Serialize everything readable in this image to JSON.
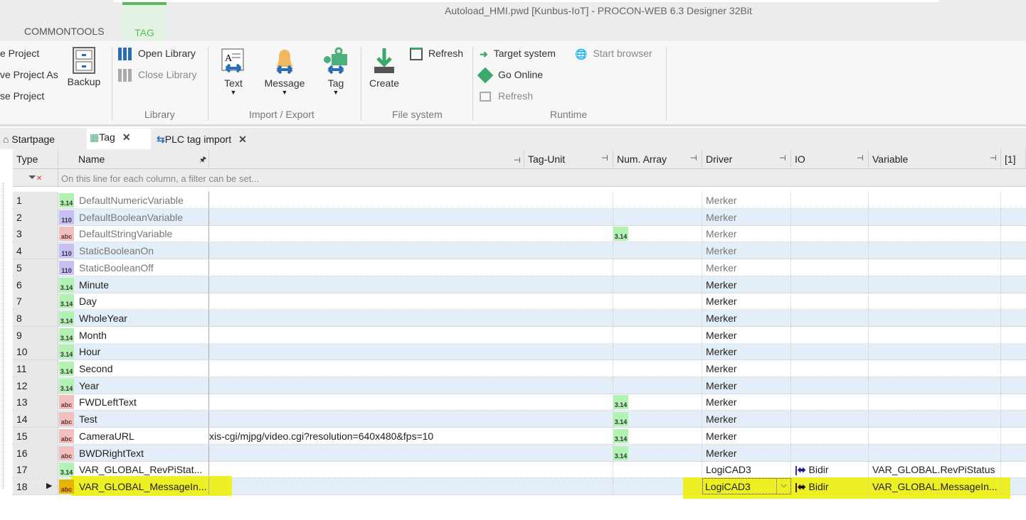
{
  "window": {
    "title": "Autoload_HMI.pwd [Kunbus-IoT] - PROCON-WEB 6.3 Designer 32Bit"
  },
  "ribbon_tabs": [
    "COMMONTOOLS",
    "TAG"
  ],
  "ribbon": {
    "project": [
      "e Project",
      "ve Project As",
      "se Project"
    ],
    "backup": "Backup",
    "library": {
      "open": "Open Library",
      "close": "Close Library",
      "label": "Library"
    },
    "import_export": {
      "text": "Text",
      "message": "Message",
      "tag": "Tag",
      "label": "Import / Export"
    },
    "file_system": {
      "create": "Create",
      "refresh": "Refresh",
      "label": "File system"
    },
    "runtime": {
      "target": "Target system",
      "browser": "Start browser",
      "online": "Go Online",
      "refresh": "Refresh",
      "label": "Runtime"
    }
  },
  "doc_tabs": [
    "Startpage",
    "Tag",
    "PLC tag import"
  ],
  "columns": [
    "Type",
    "Name",
    "",
    "Tag-Unit",
    "Num. Array",
    "Driver",
    "IO",
    "Variable",
    "[1]"
  ],
  "filter_placeholder": "On this line for each column, a filter can be set...",
  "type_icons": {
    "num": "3.14",
    "bool": "110",
    "str": "abc"
  },
  "highlight_color": "#eef000",
  "rows": [
    {
      "n": "1",
      "type": "num",
      "name": "DefaultNumericVariable",
      "val": "",
      "arr": "",
      "driver": "Merker",
      "io": "",
      "var": "",
      "grey": true
    },
    {
      "n": "2",
      "type": "bool",
      "name": "DefaultBooleanVariable",
      "val": "",
      "arr": "",
      "driver": "Merker",
      "io": "",
      "var": "",
      "grey": true
    },
    {
      "n": "3",
      "type": "str",
      "name": "DefaultStringVariable",
      "val": "",
      "arr": "3.14",
      "driver": "Merker",
      "io": "",
      "var": "",
      "grey": true
    },
    {
      "n": "4",
      "type": "bool",
      "name": "StaticBooleanOn",
      "val": "",
      "arr": "",
      "driver": "Merker",
      "io": "",
      "var": "",
      "grey": true
    },
    {
      "n": "5",
      "type": "bool",
      "name": "StaticBooleanOff",
      "val": "",
      "arr": "",
      "driver": "Merker",
      "io": "",
      "var": "",
      "grey": true
    },
    {
      "n": "6",
      "type": "num",
      "name": "Minute",
      "val": "",
      "arr": "",
      "driver": "Merker",
      "io": "",
      "var": ""
    },
    {
      "n": "7",
      "type": "num",
      "name": "Day",
      "val": "",
      "arr": "",
      "driver": "Merker",
      "io": "",
      "var": ""
    },
    {
      "n": "8",
      "type": "num",
      "name": "WholeYear",
      "val": "",
      "arr": "",
      "driver": "Merker",
      "io": "",
      "var": ""
    },
    {
      "n": "9",
      "type": "num",
      "name": "Month",
      "val": "",
      "arr": "",
      "driver": "Merker",
      "io": "",
      "var": ""
    },
    {
      "n": "10",
      "type": "num",
      "name": "Hour",
      "val": "",
      "arr": "",
      "driver": "Merker",
      "io": "",
      "var": ""
    },
    {
      "n": "11",
      "type": "num",
      "name": "Second",
      "val": "",
      "arr": "",
      "driver": "Merker",
      "io": "",
      "var": ""
    },
    {
      "n": "12",
      "type": "num",
      "name": "Year",
      "val": "",
      "arr": "",
      "driver": "Merker",
      "io": "",
      "var": ""
    },
    {
      "n": "13",
      "type": "str",
      "name": "FWDLeftText",
      "val": "",
      "arr": "3.14",
      "driver": "Merker",
      "io": "",
      "var": ""
    },
    {
      "n": "14",
      "type": "str",
      "name": "Test",
      "val": "",
      "arr": "3.14",
      "driver": "Merker",
      "io": "",
      "var": ""
    },
    {
      "n": "15",
      "type": "str",
      "name": "CameraURL",
      "val": "xis-cgi/mjpg/video.cgi?resolution=640x480&fps=10",
      "arr": "3.14",
      "driver": "Merker",
      "io": "",
      "var": ""
    },
    {
      "n": "16",
      "type": "str",
      "name": "BWDRightText",
      "val": "",
      "arr": "3.14",
      "driver": "Merker",
      "io": "",
      "var": ""
    },
    {
      "n": "17",
      "type": "num",
      "name": "VAR_GLOBAL_RevPiStat...",
      "val": "",
      "arr": "",
      "driver": "LogiCAD3",
      "io": "Bidir",
      "var": "VAR_GLOBAL.RevPiStatus"
    },
    {
      "n": "18",
      "type": "str",
      "name": "VAR_GLOBAL_MessageIn...",
      "val": "",
      "arr": "",
      "driver": "LogiCAD3",
      "io": "Bidir",
      "var": "VAR_GLOBAL.MessageIn...",
      "selected": true
    }
  ]
}
